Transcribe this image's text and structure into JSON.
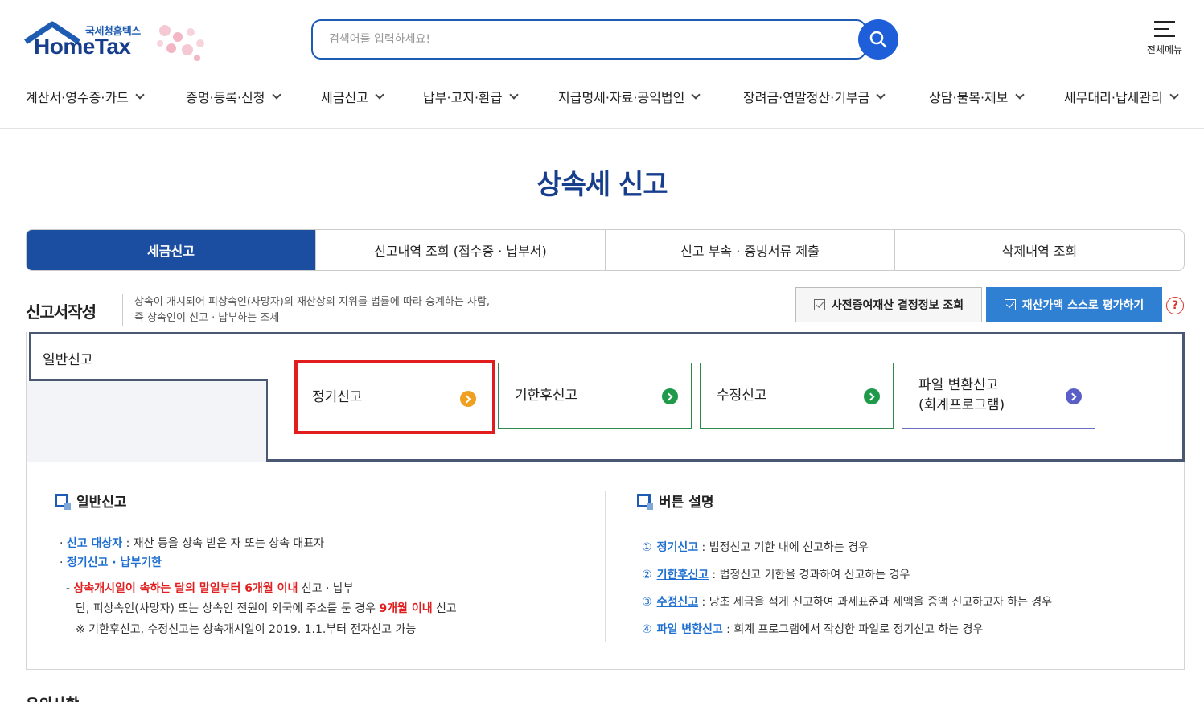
{
  "logo": {
    "sub": "국세청홈택스",
    "main": "HomeTax"
  },
  "search": {
    "placeholder": "검색어를 입력하세요!"
  },
  "allmenu": {
    "label": "전체메뉴"
  },
  "gnb": [
    "계산서·영수증·카드",
    "증명·등록·신청",
    "세금신고",
    "납부·고지·환급",
    "지급명세·자료·공익법인",
    "장려금·연말정산·기부금",
    "상담·불복·제보",
    "세무대리·납세관리"
  ],
  "page_title": "상속세 신고",
  "tabs": [
    "세금신고",
    "신고내역 조회 (접수증 · 납부서)",
    "신고 부속 · 증빙서류 제출",
    "삭제내역 조회"
  ],
  "section": {
    "title": "신고서작성",
    "desc_line1": "상속이 개시되어 피상속인(사망자)의 재산상의 지위를 법률에 따라 승계하는 사람,",
    "desc_line2": "즉 상속인이 신고 · 납부하는 조세",
    "btn_gray": "사전증여재산 결정정보 조회",
    "btn_blue": "재산가액 스스로 평가하기",
    "help": "?"
  },
  "filing": {
    "tab_label": "일반신고",
    "options": [
      {
        "label": "정기신고",
        "color": "#f0a020"
      },
      {
        "label": "기한후신고",
        "color": "#1f9a4a"
      },
      {
        "label": "수정신고",
        "color": "#1f9a4a"
      },
      {
        "label_line1": "파일 변환신고",
        "label_line2": "(회계프로그램)",
        "color": "#5a5fc8"
      }
    ]
  },
  "left_info": {
    "heading": "일반신고",
    "target_label": "신고 대상자",
    "target_text": " : 재산 등을 상속 받은 자 또는 상속 대표자",
    "deadline_label": "정기신고 · 납부기한",
    "deadline_red": "상속개시일이 속하는 달의 말일부터 6개월 이내",
    "deadline_after": " 신고 · 납부",
    "foreign_before": "단, 피상속인(사망자) 또는 상속인 전원이 외국에 주소를 둔 경우 ",
    "foreign_red": "9개월 이내",
    "foreign_after": " 신고",
    "note": "※ 기한후신고, 수정신고는 상속개시일이 2019. 1.1.부터 전자신고 가능"
  },
  "right_info": {
    "heading": "버튼 설명",
    "items": [
      {
        "num": "①",
        "label": "정기신고",
        "text": " : 법정신고 기한 내에 신고하는 경우"
      },
      {
        "num": "②",
        "label": "기한후신고",
        "text": " : 법정신고 기한을 경과하여 신고하는 경우"
      },
      {
        "num": "③",
        "label": "수정신고",
        "text": " : 당초 세금을 적게 신고하여 과세표준과 세액을 증액 신고하고자 하는 경우"
      },
      {
        "num": "④",
        "label": "파일 변환신고",
        "text": " : 회계 프로그램에서 작성한 파일로 정기신고 하는 경우"
      }
    ]
  },
  "bottom_cut": "유의사항"
}
